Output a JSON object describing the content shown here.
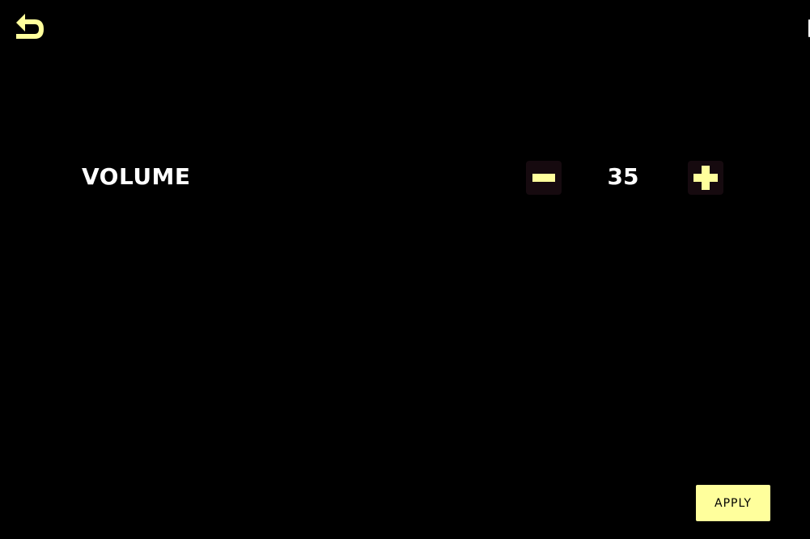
{
  "header": {
    "back_icon": "undo-arrow-icon"
  },
  "settings": {
    "volume": {
      "label": "VOLUME",
      "value": "35",
      "decrease_icon": "minus-icon",
      "increase_icon": "plus-icon"
    }
  },
  "footer": {
    "apply_label": "APPLY"
  },
  "colors": {
    "background": "#000000",
    "accent": "#ffff9c",
    "text": "#ffffff",
    "button_bg": "#160a0f"
  }
}
